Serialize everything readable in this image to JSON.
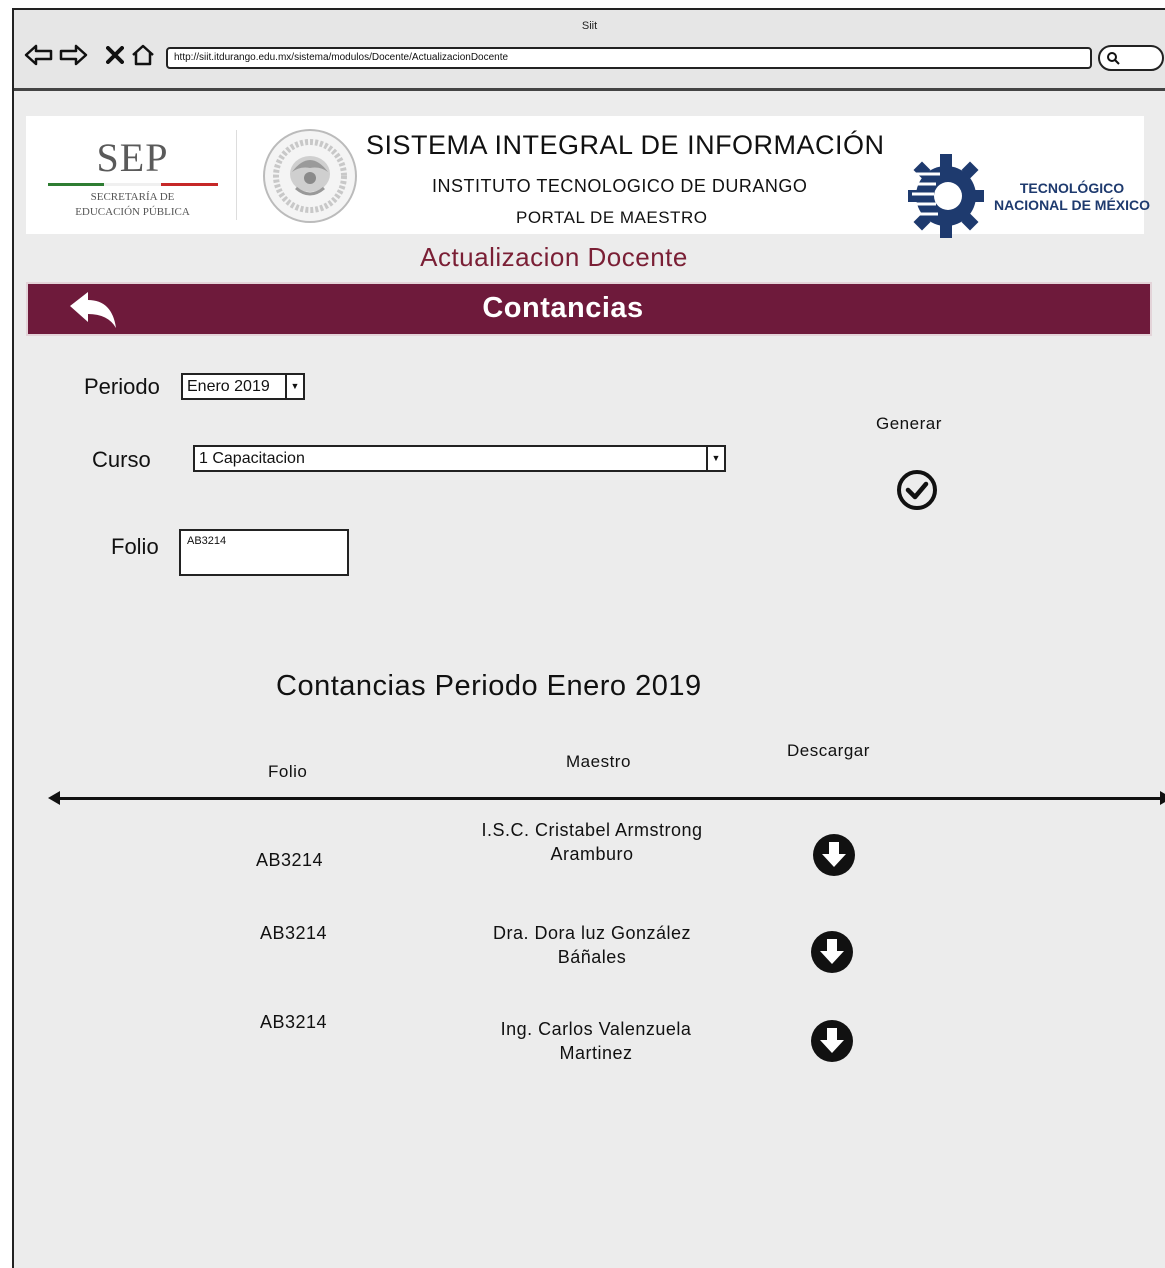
{
  "browser": {
    "window_title": "Siit",
    "url": "http://siit.itdurango.edu.mx/sistema/modulos/Docente/ActualizacionDocente"
  },
  "header": {
    "sep_logo_text": "SEP",
    "sep_subtitle_line1": "SECRETARÍA DE",
    "sep_subtitle_line2": "EDUCACIÓN PÚBLICA",
    "system_title": "SISTEMA INTEGRAL DE INFORMACIÓN",
    "institute": "INSTITUTO TECNOLOGICO DE DURANGO",
    "portal": "PORTAL DE MAESTRO",
    "tecnm_line1": "TECNOLÓGICO",
    "tecnm_line2": "NACIONAL DE MÉXICO"
  },
  "page": {
    "subtitle": "Actualizacion Docente",
    "bar_title": "Contancias"
  },
  "form": {
    "periodo_label": "Periodo",
    "periodo_value": "Enero 2019",
    "curso_label": "Curso",
    "curso_value": "1 Capacitacion",
    "folio_label": "Folio",
    "folio_value": "AB3214",
    "generar_label": "Generar"
  },
  "list": {
    "title": "Contancias Periodo Enero 2019",
    "columns": {
      "folio": "Folio",
      "maestro": "Maestro",
      "descargar": "Descargar"
    },
    "rows": [
      {
        "folio": "AB3214",
        "maestro_line1": "I.S.C. Cristabel Armstrong",
        "maestro_line2": "Aramburo"
      },
      {
        "folio": "AB3214",
        "maestro_line1": "Dra. Dora luz González",
        "maestro_line2": "Báñales"
      },
      {
        "folio": "AB3214",
        "maestro_line1": "Ing. Carlos Valenzuela",
        "maestro_line2": "Martinez"
      }
    ]
  },
  "colors": {
    "maroon": "#6e1a3b",
    "subtitle": "#7a1f35",
    "tecnm_blue": "#1e3a6e"
  },
  "icons": {
    "back": "back-icon",
    "forward": "forward-icon",
    "stop": "close-icon",
    "home": "home-icon",
    "search": "search-icon",
    "return": "return-arrow-icon",
    "generate": "check-circle-icon",
    "download": "download-circle-icon"
  }
}
